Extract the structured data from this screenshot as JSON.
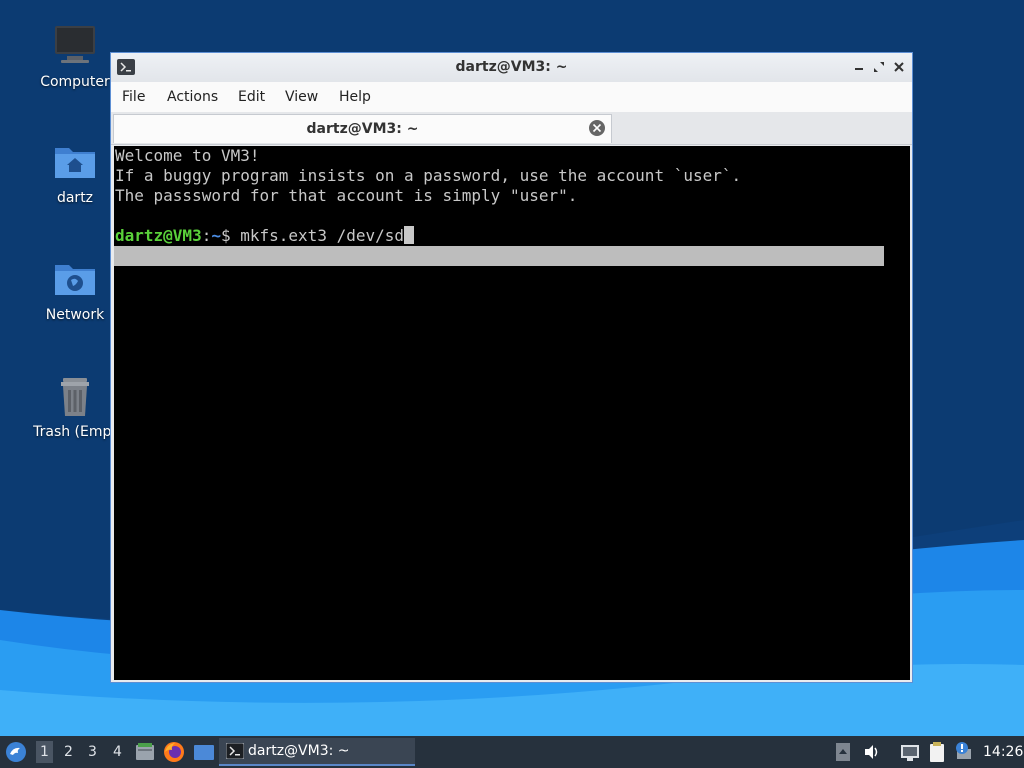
{
  "desktop": {
    "icons": [
      {
        "label": "Computer",
        "icon": "computer-icon"
      },
      {
        "label": "dartz",
        "icon": "home-folder-icon"
      },
      {
        "label": "Network",
        "icon": "network-folder-icon"
      },
      {
        "label": "Trash (Empt",
        "icon": "trash-icon"
      }
    ]
  },
  "window": {
    "title": "dartz@VM3: ~",
    "menu": [
      "File",
      "Actions",
      "Edit",
      "View",
      "Help"
    ],
    "tab_label": "dartz@VM3: ~"
  },
  "terminal": {
    "lines": [
      "Welcome to VM3!",
      "If a buggy program insists on a password, use the account `user`.",
      "The passsword for that account is simply \"user\"."
    ],
    "prompt_user": "dartz@VM3",
    "prompt_sep": ":",
    "prompt_path": "~",
    "prompt_symbol": "$ ",
    "command": "mkfs.ext3 /dev/sd"
  },
  "taskbar": {
    "workspaces": [
      "1",
      "2",
      "3",
      "4"
    ],
    "task_label": "dartz@VM3: ~",
    "clock": "14:26"
  },
  "colors": {
    "prompt_user": "#5ad13a",
    "prompt_path": "#4c8ee6",
    "window_border": "#5d8fd4",
    "taskbar": "#26313d"
  }
}
